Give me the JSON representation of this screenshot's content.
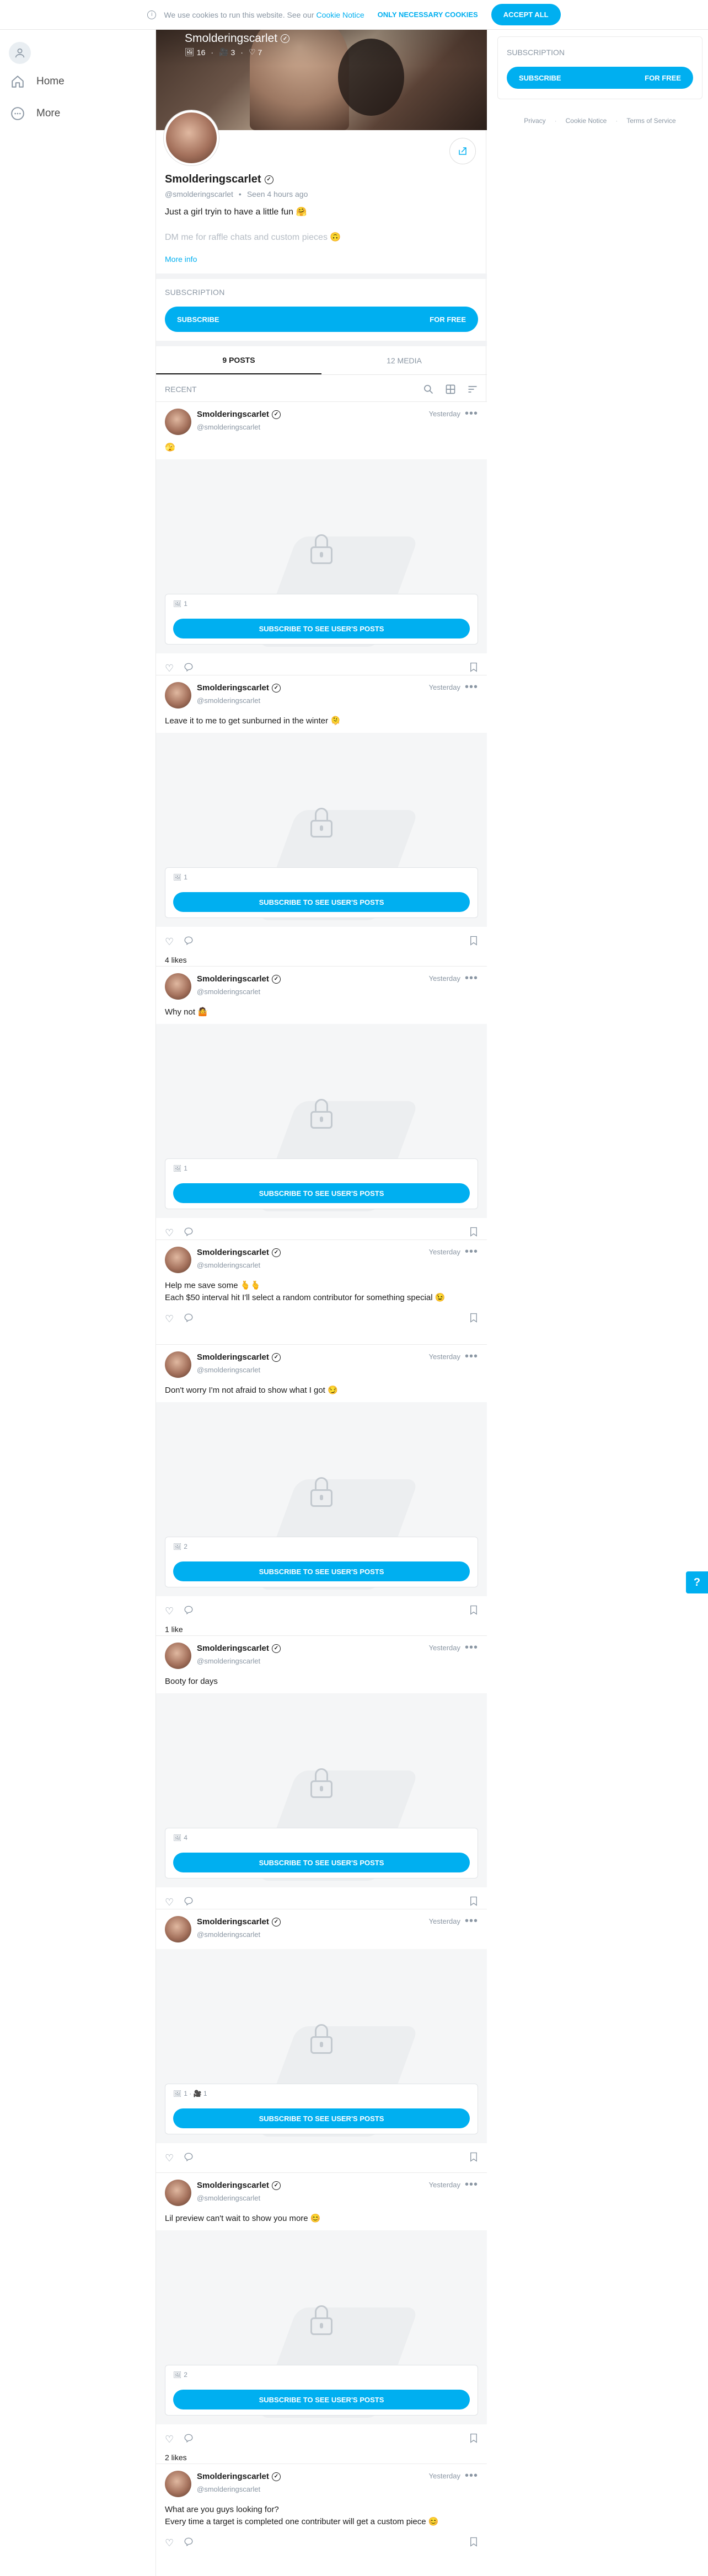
{
  "cookie": {
    "text": "We use cookies to run this website. See our",
    "link": "Cookie Notice",
    "necessary": "Only necessary cookies",
    "accept": "Accept all"
  },
  "nav": {
    "items": [
      {
        "label": "Home",
        "icon": "home-icon"
      },
      {
        "label": "More",
        "icon": "more-circle-icon"
      }
    ]
  },
  "profile": {
    "name": "Smolderingscarlet",
    "stats": {
      "images": "16",
      "videos": "3",
      "likes": "7"
    },
    "handle": "@smolderingscarlet",
    "seen": "Seen 4 hours ago",
    "bio_line1": "Just a girl tryin to have a little fun 🤗",
    "bio_line2": "DM me for raffle chats and custom pieces 🙃",
    "more_info": "More info"
  },
  "subscription": {
    "title": "Subscription",
    "button_label": "Subscribe",
    "button_price": "For free"
  },
  "tabs": [
    {
      "label": "9 Posts",
      "active": true
    },
    {
      "label": "12 Media",
      "active": false
    }
  ],
  "recent_label": "Recent",
  "lock_button": "Subscribe to see user's posts",
  "posts": [
    {
      "date": "Yesterday",
      "text": "🫣",
      "locked": true,
      "count": "1",
      "likes": ""
    },
    {
      "date": "Yesterday",
      "text": "Leave it to me to get sunburned in the winter 🫠",
      "locked": true,
      "count": "1",
      "likes": "4 likes"
    },
    {
      "date": "Yesterday",
      "text": "Why not 🤷",
      "locked": true,
      "count": "1",
      "likes": ""
    },
    {
      "date": "Yesterday",
      "text": "Help me save some 🫰🫰\nEach $50 interval hit I'll select a random contributor for something special 😉",
      "locked": false,
      "count": "",
      "likes": ""
    },
    {
      "date": "Yesterday",
      "text": "Don't worry I'm not afraid to show what I got 😏",
      "locked": true,
      "count": "2",
      "likes": "1 like"
    },
    {
      "date": "Yesterday",
      "text": "Booty for days",
      "locked": true,
      "count": "4",
      "likes": ""
    },
    {
      "date": "Yesterday",
      "text": "",
      "locked": true,
      "count": "1 · 🎥 1",
      "likes": ""
    },
    {
      "date": "Yesterday",
      "text": "Lil preview can't wait to show you more 😊",
      "locked": true,
      "count": "2",
      "likes": "2 likes"
    },
    {
      "date": "Yesterday",
      "text": "What are you guys looking for?\nEvery time a target is completed one contributer will get a custom piece 😊",
      "locked": false,
      "count": "",
      "likes": ""
    }
  ],
  "right": {
    "title": "Subscription",
    "button_label": "Subscribe",
    "button_price": "For free",
    "footer": [
      "Privacy",
      "Cookie Notice",
      "Terms of Service"
    ]
  },
  "help": "?",
  "colors": {
    "accent": "#00aff0",
    "muted": "#8a96a3"
  }
}
